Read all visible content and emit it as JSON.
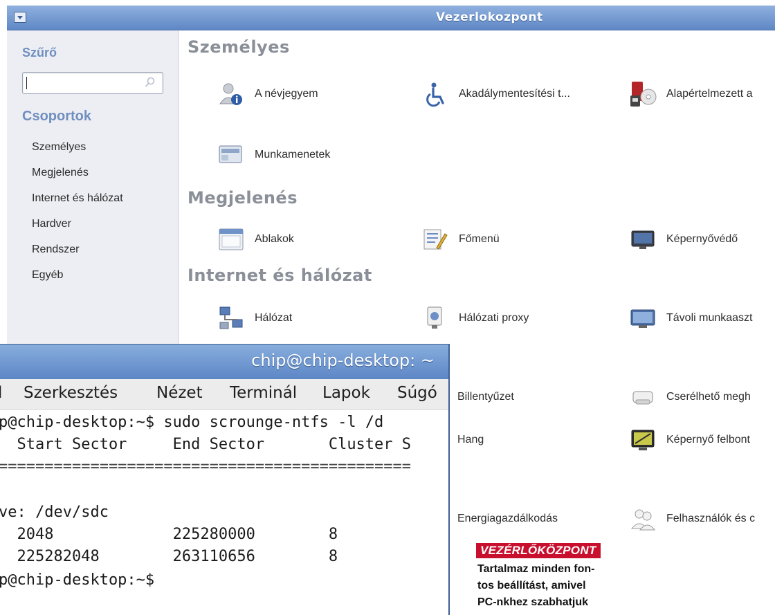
{
  "control_center": {
    "title": "Vezerlokozpont",
    "sidebar": {
      "filter_label": "Szűrő",
      "search_value": "",
      "groups_label": "Csoportok",
      "groups": [
        "Személyes",
        "Megjelenés",
        "Internet és hálózat",
        "Hardver",
        "Rendszer",
        "Egyéb"
      ]
    },
    "sections": [
      {
        "title": "Személyes",
        "items": [
          {
            "label": "A névjegyem",
            "icon": "user-info-icon"
          },
          {
            "label": "Akadálymentesítési t...",
            "icon": "accessibility-icon"
          },
          {
            "label": "Alapértelmezett a",
            "icon": "default-apps-icon"
          },
          {
            "label": "Munkamenetek",
            "icon": "sessions-icon"
          }
        ]
      },
      {
        "title": "Megjelenés",
        "items": [
          {
            "label": "Ablakok",
            "icon": "windows-icon"
          },
          {
            "label": "Főmenü",
            "icon": "main-menu-icon"
          },
          {
            "label": "Képernyővédő",
            "icon": "screensaver-icon"
          }
        ]
      },
      {
        "title": "Internet és hálózat",
        "items": [
          {
            "label": "Hálózat",
            "icon": "network-icon"
          },
          {
            "label": "Hálózati proxy",
            "icon": "network-proxy-icon"
          },
          {
            "label": "Távoli munkaaszt",
            "icon": "remote-desktop-icon"
          }
        ]
      }
    ],
    "hardware_items": [
      {
        "label": "Billentyűzet",
        "icon": "keyboard-icon"
      },
      {
        "label": "Cserélhető megh",
        "icon": "removable-drives-icon"
      },
      {
        "label": "Hang",
        "icon": "sound-icon"
      },
      {
        "label": "Képernyő felbont",
        "icon": "display-resolution-icon"
      },
      {
        "label": "Energiagazdálkodás",
        "icon": "power-management-icon"
      },
      {
        "label": "Felhasználók és c",
        "icon": "users-groups-icon"
      }
    ]
  },
  "terminal": {
    "title": "chip@chip-desktop: ~",
    "menu": [
      "l",
      "Szerkesztés",
      "Nézet",
      "Terminál",
      "Lapok",
      "Súgó"
    ],
    "lines": [
      "p@chip-desktop:~$ sudo scrounge-ntfs -l /d",
      "  Start Sector     End Sector       Cluster S",
      "=============================================",
      "",
      "ve: /dev/sdc",
      "  2048             225280000        8",
      "  225282048        263110656        8",
      "p@chip-desktop:~$"
    ]
  },
  "caption": {
    "tag": "VEZÉRLŐKÖZPONT",
    "lines": [
      "Tartalmaz minden fon-",
      "tos beállítást, amivel",
      "PC-nkhez szabhatjuk"
    ]
  }
}
